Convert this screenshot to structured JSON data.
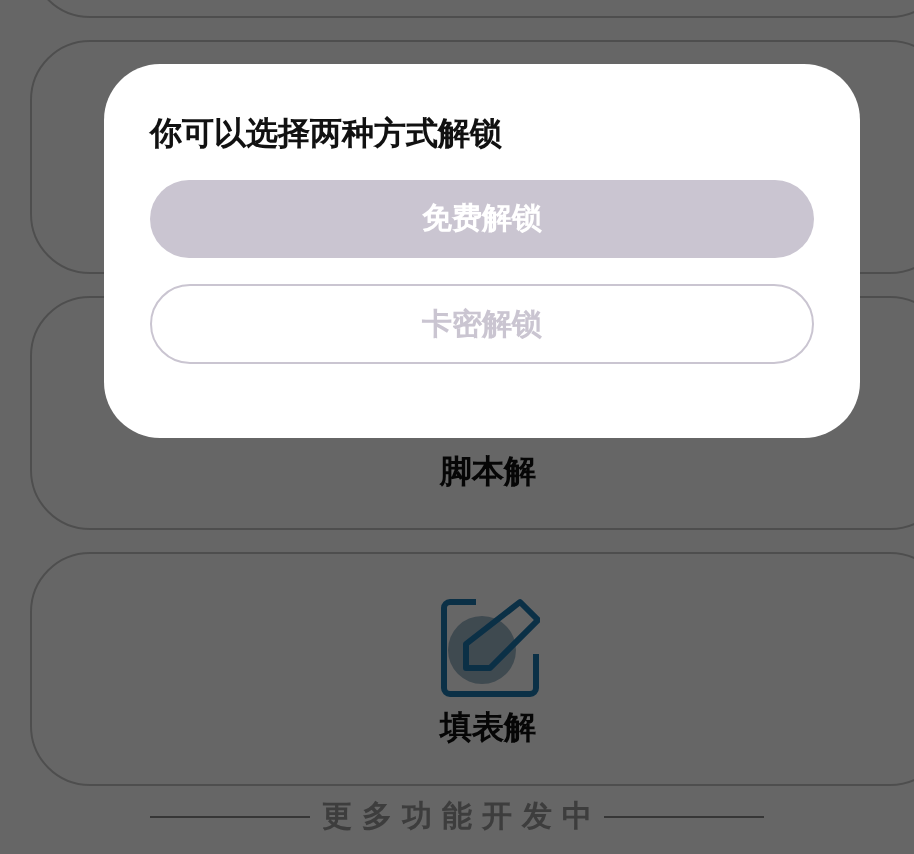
{
  "cards": [
    {
      "kind": "empty"
    },
    {
      "kind": "empty"
    },
    {
      "kind": "script",
      "label": "脚本解"
    },
    {
      "kind": "form",
      "label": "填表解"
    }
  ],
  "footer": {
    "text": "更多功能开发中"
  },
  "dialog": {
    "title": "你可以选择两种方式解锁",
    "buttons": [
      {
        "label": "免费解锁",
        "kind": "filled"
      },
      {
        "label": "卡密解锁",
        "kind": "outline"
      }
    ]
  }
}
